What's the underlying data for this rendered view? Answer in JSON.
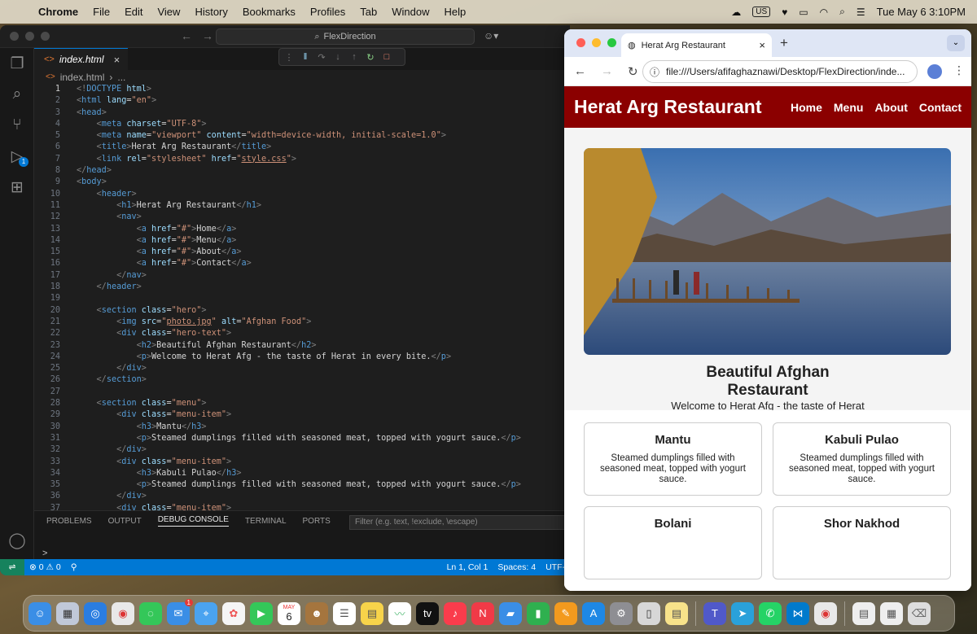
{
  "menubar": {
    "app": "Chrome",
    "items": [
      "File",
      "Edit",
      "View",
      "History",
      "Bookmarks",
      "Profiles",
      "Tab",
      "Window",
      "Help"
    ],
    "input_source": "US",
    "clock": "Tue May 6  3:10PM"
  },
  "vscode": {
    "search": "FlexDirection",
    "tab": "index.html",
    "breadcrumb": [
      "index.html",
      "..."
    ],
    "code_lines": [
      "<!DOCTYPE html>",
      "<html lang=\"en\">",
      "<head>",
      "    <meta charset=\"UTF-8\">",
      "    <meta name=\"viewport\" content=\"width=device-width, initial-scale=1.0\">",
      "    <title>Herat Arg Restaurant</title>",
      "    <link rel=\"stylesheet\" href=\"style.css\">",
      "</head>",
      "<body>",
      "    <header>",
      "        <h1>Herat Arg Restaurant</h1>",
      "        <nav>",
      "            <a href=\"#\">Home</a>",
      "            <a href=\"#\">Menu</a>",
      "            <a href=\"#\">About</a>",
      "            <a href=\"#\">Contact</a>",
      "        </nav>",
      "    </header>",
      "",
      "    <section class=\"hero\">",
      "        <img src=\"photo.jpg\" alt=\"Afghan Food\">",
      "        <div class=\"hero-text\">",
      "            <h2>Beautiful Afghan Restaurant</h2>",
      "            <p>Welcome to Herat Afg - the taste of Herat in every bite.</p>",
      "        </div>",
      "    </section>",
      "",
      "    <section class=\"menu\">",
      "        <div class=\"menu-item\">",
      "            <h3>Mantu</h3>",
      "            <p>Steamed dumplings filled with seasoned meat, topped with yogurt sauce.</p>",
      "        </div>",
      "        <div class=\"menu-item\">",
      "            <h3>Kabuli Pulao</h3>",
      "            <p>Steamed dumplings filled with seasoned meat, topped with yogurt sauce.</p>",
      "        </div>",
      "        <div class=\"menu-item\">"
    ],
    "panel_tabs": [
      "PROBLEMS",
      "OUTPUT",
      "DEBUG CONSOLE",
      "TERMINAL",
      "PORTS"
    ],
    "panel_active": "DEBUG CONSOLE",
    "filter_placeholder": "Filter (e.g. text, !exclude, \\escape)",
    "prompt": ">",
    "status": {
      "errors": "0",
      "warnings": "0",
      "position": "Ln 1, Col 1",
      "spaces": "Spaces: 4",
      "encoding": "UTF-"
    },
    "run_badge": "1"
  },
  "chrome": {
    "tab_title": "Herat Arg Restaurant",
    "url": "file:///Users/afifaghaznawi/Desktop/FlexDirection/inde..."
  },
  "site": {
    "title": "Herat Arg Restaurant",
    "nav": [
      "Home",
      "Menu",
      "About",
      "Contact"
    ],
    "hero_heading": "Beautiful Afghan Restaurant",
    "hero_text": "Welcome to Herat Afg - the taste of Herat in every bite.",
    "menu_items": [
      {
        "name": "Mantu",
        "desc": "Steamed dumplings filled with seasoned meat, topped with yogurt sauce."
      },
      {
        "name": "Kabuli Pulao",
        "desc": "Steamed dumplings filled with seasoned meat, topped with yogurt sauce."
      },
      {
        "name": "Bolani",
        "desc": ""
      },
      {
        "name": "Shor Nakhod",
        "desc": ""
      }
    ]
  },
  "dock": {
    "mail_badge": "1",
    "calendar_month": "MAY",
    "calendar_day": "6"
  },
  "colors": {
    "site_header": "#8b0000",
    "vscode_status": "#0078d4"
  }
}
